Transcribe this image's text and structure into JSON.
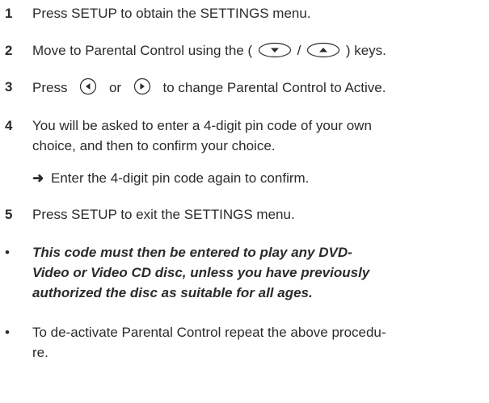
{
  "steps": [
    {
      "num": "1",
      "text": "Press SETUP to obtain the SETTINGS menu."
    },
    {
      "num": "2",
      "before": "Move to Parental Control using the (",
      "sep": "/",
      "after": ") keys."
    },
    {
      "num": "3",
      "before": "Press",
      "or": "or",
      "after": "to change Parental Control to Active."
    },
    {
      "num": "4",
      "line1": "You will be asked to enter a 4-digit pin code of your own",
      "line2": "choice, and then to confirm your choice.",
      "arrow": "➜",
      "sub": "Enter the 4-digit pin code again to confirm."
    },
    {
      "num": "5",
      "text": "Press SETUP to exit the SETTINGS menu."
    }
  ],
  "bullets": [
    {
      "marker": "•",
      "lines": [
        "This code must then be entered to play any DVD-",
        "Video or Video CD disc, unless you have previously",
        "authorized the disc as suitable for all ages."
      ]
    },
    {
      "marker": "•",
      "lines": [
        "To de-activate Parental Control repeat the above procedu-",
        "re."
      ]
    }
  ],
  "icons": {
    "down_key": "down-oval-key-icon",
    "up_key": "up-oval-key-icon",
    "left_key": "left-circle-key-icon",
    "right_key": "right-circle-key-icon"
  }
}
